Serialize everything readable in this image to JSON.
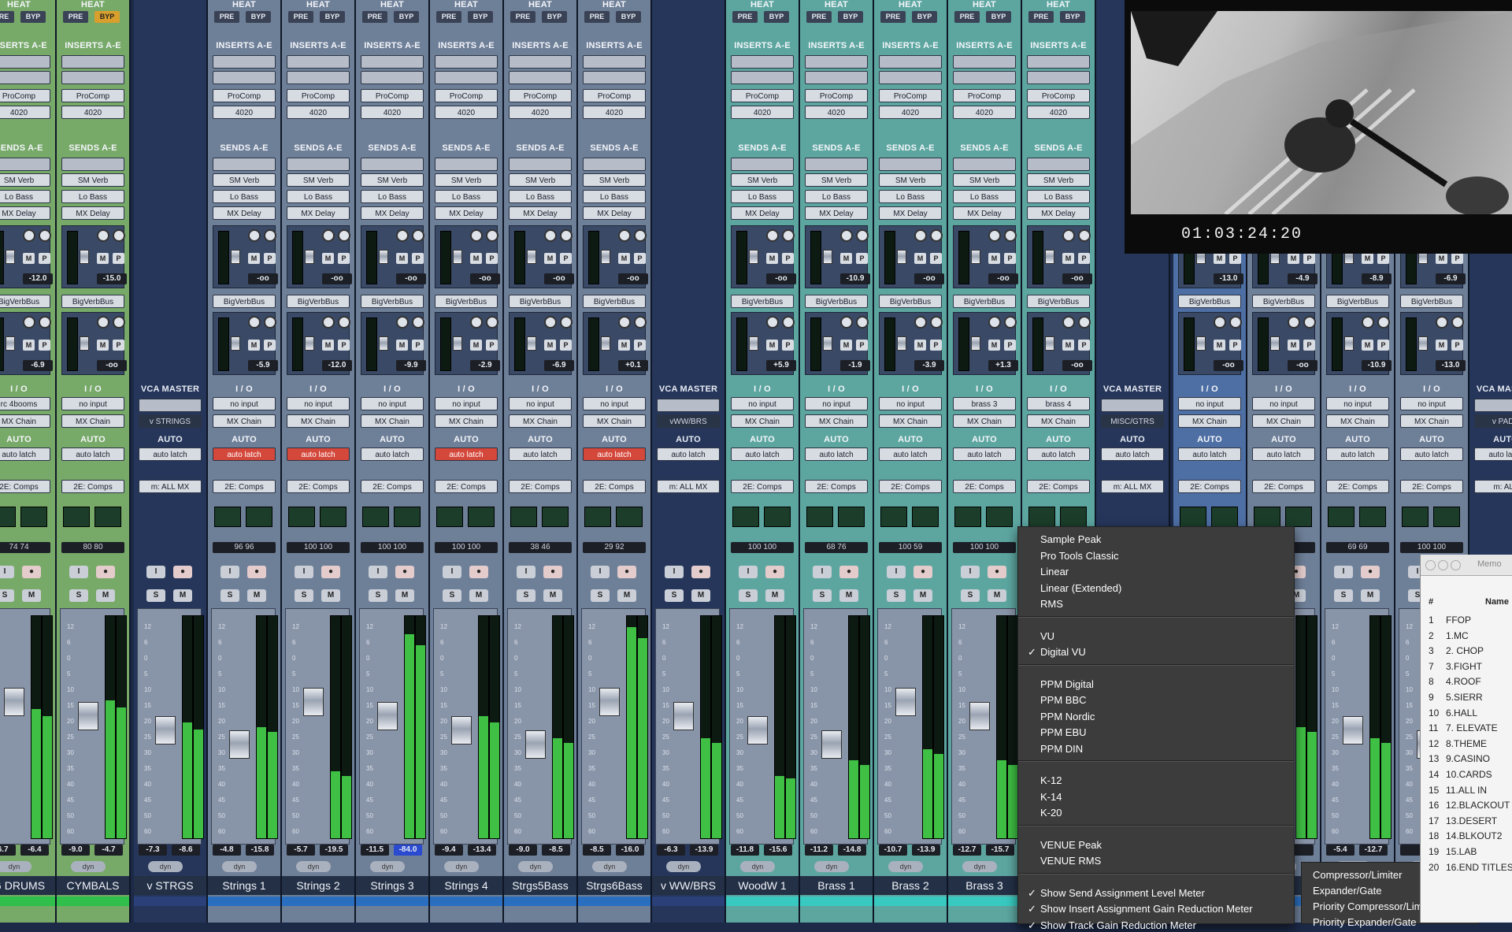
{
  "strip_labels": {
    "heat": "HEAT",
    "pre": "PRE",
    "byp": "BYP",
    "inserts": "INSERTS A-E",
    "sends": "SENDS A-E",
    "io": "I / O",
    "vca_master": "VCA MASTER",
    "auto": "AUTO",
    "dyn": "dyn"
  },
  "tracks": [
    {
      "kind": "audio",
      "color": "green",
      "name": "G DRUMS",
      "insert1": "ProComp",
      "insert2": "4020",
      "sends": [
        "SM Verb",
        "Lo Bass",
        "MX Delay"
      ],
      "send_val1": "-12.0",
      "bus": "BigVerbBus",
      "send_val2": "-6.9",
      "input": "rc 4booms",
      "output": "MX Chain",
      "auto": "auto latch",
      "auto_armed": false,
      "group": "2E: Comps",
      "pan": "74  74",
      "vol_left": "-6.7",
      "vol_right": "-6.4",
      "level": 0.58,
      "byp_on": false
    },
    {
      "kind": "audio",
      "color": "green",
      "name": "CYMBALS",
      "insert1": "ProComp",
      "insert2": "4020",
      "sends": [
        "SM Verb",
        "Lo Bass",
        "MX Delay"
      ],
      "send_val1": "-15.0",
      "bus": "BigVerbBus",
      "send_val2": "-oo",
      "input": "no input",
      "output": "MX Chain",
      "auto": "auto latch",
      "auto_armed": false,
      "group": "2E: Comps",
      "pan": "80  80",
      "vol_left": "-9.0",
      "vol_right": "-4.7",
      "level": 0.62,
      "byp_on": true
    },
    {
      "kind": "vca",
      "color": "vca",
      "name": "v STRGS",
      "vca": "v STRINGS",
      "auto": "auto latch",
      "auto_armed": false,
      "group": "m: ALL MX",
      "vol_left": "-7.3",
      "vol_right": "-8.6",
      "level": 0.52
    },
    {
      "kind": "audio",
      "color": "grey",
      "name": "Strings 1",
      "insert1": "ProComp",
      "insert2": "4020",
      "sends": [
        "SM Verb",
        "Lo Bass",
        "MX Delay"
      ],
      "send_val1": "-oo",
      "bus": "BigVerbBus",
      "send_val2": "-5.9",
      "input": "no input",
      "output": "MX Chain",
      "auto": "auto latch",
      "auto_armed": true,
      "group": "2E: Comps",
      "pan": "96  96",
      "vol_left": "-4.8",
      "vol_right": "-15.8",
      "level": 0.5,
      "byp_on": false
    },
    {
      "kind": "audio",
      "color": "grey",
      "name": "Strings 2",
      "insert1": "ProComp",
      "insert2": "4020",
      "sends": [
        "SM Verb",
        "Lo Bass",
        "MX Delay"
      ],
      "send_val1": "-oo",
      "bus": "BigVerbBus",
      "send_val2": "-12.0",
      "input": "no input",
      "output": "MX Chain",
      "auto": "auto latch",
      "auto_armed": true,
      "group": "2E: Comps",
      "pan": "100  100",
      "vol_left": "-5.7",
      "vol_right": "-19.5",
      "level": 0.3,
      "byp_on": false
    },
    {
      "kind": "audio",
      "color": "grey",
      "name": "Strings 3",
      "insert1": "ProComp",
      "insert2": "4020",
      "sends": [
        "SM Verb",
        "Lo Bass",
        "MX Delay"
      ],
      "send_val1": "-oo",
      "bus": "BigVerbBus",
      "send_val2": "-9.9",
      "input": "no input",
      "output": "MX Chain",
      "auto": "auto latch",
      "auto_armed": false,
      "group": "2E: Comps",
      "pan": "100  100",
      "vol_left": "-11.5",
      "vol_right": "-84.0",
      "level": 0.92,
      "byp_on": false
    },
    {
      "kind": "audio",
      "color": "grey",
      "name": "Strings 4",
      "insert1": "ProComp",
      "insert2": "4020",
      "sends": [
        "SM Verb",
        "Lo Bass",
        "MX Delay"
      ],
      "send_val1": "-oo",
      "bus": "BigVerbBus",
      "send_val2": "-2.9",
      "input": "no input",
      "output": "MX Chain",
      "auto": "auto latch",
      "auto_armed": true,
      "group": "2E: Comps",
      "pan": "100  100",
      "vol_left": "-9.4",
      "vol_right": "-13.4",
      "level": 0.55,
      "byp_on": false
    },
    {
      "kind": "audio",
      "color": "grey",
      "name": "Strgs5Bass",
      "insert1": "ProComp",
      "insert2": "4020",
      "sends": [
        "SM Verb",
        "Lo Bass",
        "MX Delay"
      ],
      "send_val1": "-oo",
      "bus": "BigVerbBus",
      "send_val2": "-6.9",
      "input": "no input",
      "output": "MX Chain",
      "auto": "auto latch",
      "auto_armed": false,
      "group": "2E: Comps",
      "pan": "38  46",
      "vol_left": "-9.0",
      "vol_right": "-8.5",
      "level": 0.45,
      "byp_on": false
    },
    {
      "kind": "audio",
      "color": "grey",
      "name": "Strgs6Bass",
      "insert1": "ProComp",
      "insert2": "4020",
      "sends": [
        "SM Verb",
        "Lo Bass",
        "MX Delay"
      ],
      "send_val1": "-oo",
      "bus": "BigVerbBus",
      "send_val2": "+0.1",
      "input": "no input",
      "output": "MX Chain",
      "auto": "auto latch",
      "auto_armed": true,
      "group": "2E: Comps",
      "pan": "29  92",
      "vol_left": "-8.5",
      "vol_right": "-16.0",
      "level": 0.95,
      "byp_on": false
    },
    {
      "kind": "vca",
      "color": "vca",
      "name": "v WW/BRS",
      "vca": "vWW/BRS",
      "auto": "auto latch",
      "auto_armed": false,
      "group": "m: ALL MX",
      "vol_left": "-6.3",
      "vol_right": "-13.9",
      "level": 0.45
    },
    {
      "kind": "audio",
      "color": "teal",
      "name": "WoodW 1",
      "insert1": "ProComp",
      "insert2": "4020",
      "sends": [
        "SM Verb",
        "Lo Bass",
        "MX Delay"
      ],
      "send_val1": "-oo",
      "bus": "BigVerbBus",
      "send_val2": "+5.9",
      "input": "no input",
      "output": "MX Chain",
      "auto": "auto latch",
      "auto_armed": false,
      "group": "2E: Comps",
      "pan": "100  100",
      "vol_left": "-11.8",
      "vol_right": "-15.6",
      "level": 0.28,
      "byp_on": false
    },
    {
      "kind": "audio",
      "color": "teal",
      "name": "Brass 1",
      "insert1": "ProComp",
      "insert2": "4020",
      "sends": [
        "SM Verb",
        "Lo Bass",
        "MX Delay"
      ],
      "send_val1": "-10.9",
      "bus": "BigVerbBus",
      "send_val2": "-1.9",
      "input": "no input",
      "output": "MX Chain",
      "auto": "auto latch",
      "auto_armed": false,
      "group": "2E: Comps",
      "pan": "68  76",
      "vol_left": "-11.2",
      "vol_right": "-14.8",
      "level": 0.35,
      "byp_on": false
    },
    {
      "kind": "audio",
      "color": "teal",
      "name": "Brass 2",
      "insert1": "ProComp",
      "insert2": "4020",
      "sends": [
        "SM Verb",
        "Lo Bass",
        "MX Delay"
      ],
      "send_val1": "-oo",
      "bus": "BigVerbBus",
      "send_val2": "-3.9",
      "input": "no input",
      "output": "MX Chain",
      "auto": "auto latch",
      "auto_armed": false,
      "group": "2E: Comps",
      "pan": "100  59",
      "vol_left": "-10.7",
      "vol_right": "-13.9",
      "level": 0.4,
      "byp_on": false
    },
    {
      "kind": "audio",
      "color": "teal",
      "name": "Brass 3",
      "insert1": "ProComp",
      "insert2": "4020",
      "sends": [
        "SM Verb",
        "Lo Bass",
        "MX Delay"
      ],
      "send_val1": "-oo",
      "bus": "BigVerbBus",
      "send_val2": "+1.3",
      "input": "brass 3",
      "output": "MX Chain",
      "auto": "auto latch",
      "auto_armed": false,
      "group": "2E: Comps",
      "pan": "100  100",
      "vol_left": "-12.7",
      "vol_right": "-15.7",
      "level": 0.35,
      "byp_on": false
    },
    {
      "kind": "audio",
      "color": "teal",
      "name": "Brass 4",
      "insert1": "ProComp",
      "insert2": "4020",
      "sends": [
        "SM Verb",
        "Lo Bass",
        "MX Delay"
      ],
      "send_val1": "-oo",
      "bus": "BigVerbBus",
      "send_val2": "-oo",
      "input": "brass 4",
      "output": "MX Chain",
      "auto": "auto latch",
      "auto_armed": false,
      "group": "2E: Comps",
      "pan": "",
      "vol_left": "",
      "vol_right": "",
      "level": 0.3,
      "byp_on": false
    },
    {
      "kind": "vca",
      "color": "vca",
      "name": "",
      "vca": "MISC/GTRS",
      "auto": "auto latch",
      "auto_armed": false,
      "group": "m: ALL MX",
      "vol_left": "",
      "vol_right": "",
      "level": 0.3
    },
    {
      "kind": "audio",
      "color": "blue",
      "name": "",
      "insert1": "",
      "insert2": "",
      "sends": [
        "",
        "",
        ""
      ],
      "send_val1": "-13.0",
      "bus": "BigVerbBus",
      "send_val2": "-oo",
      "input": "no input",
      "output": "MX Chain",
      "auto": "auto latch",
      "auto_armed": false,
      "group": "2E: Comps",
      "pan": "",
      "vol_left": "",
      "vol_right": "",
      "level": 0.5,
      "byp_on": false
    },
    {
      "kind": "audio",
      "color": "grey",
      "name": "",
      "insert1": "",
      "insert2": "",
      "sends": [
        "",
        "",
        ""
      ],
      "send_val1": "-4.9",
      "bus": "BigVerbBus",
      "send_val2": "-oo",
      "input": "no input",
      "output": "MX Chain",
      "auto": "auto latch",
      "auto_armed": false,
      "group": "2E: Comps",
      "pan": "",
      "vol_left": "",
      "vol_right": "",
      "level": 0.5,
      "byp_on": false
    },
    {
      "kind": "audio",
      "color": "grey",
      "name": "",
      "insert1": "",
      "insert2": "",
      "sends": [
        "",
        "",
        ""
      ],
      "send_val1": "-8.9",
      "bus": "BigVerbBus",
      "send_val2": "-10.9",
      "input": "no input",
      "output": "MX Chain",
      "auto": "auto latch",
      "auto_armed": false,
      "group": "2E: Comps",
      "pan": "69  69",
      "vol_left": "-5.4",
      "vol_right": "-12.7",
      "level": 0.45,
      "byp_on": false
    },
    {
      "kind": "audio",
      "color": "grey",
      "name": "",
      "insert1": "",
      "insert2": "",
      "sends": [
        "",
        "",
        ""
      ],
      "send_val1": "-6.9",
      "bus": "BigVerbBus",
      "send_val2": "-13.0",
      "input": "no input",
      "output": "MX Chain",
      "auto": "auto latch",
      "auto_armed": false,
      "group": "2E: Comps",
      "pan": "100  100",
      "vol_left": "",
      "vol_right": "",
      "level": 0.5,
      "byp_on": false
    },
    {
      "kind": "vca",
      "color": "vca",
      "name": "",
      "vca": "v PADS",
      "auto": "auto latch",
      "auto_armed": false,
      "group": "m: ALL",
      "vol_left": "",
      "vol_right": "",
      "level": 0.5
    }
  ],
  "scale_ticks": [
    "12",
    "6",
    "0",
    "5",
    "10",
    "15",
    "20",
    "25",
    "30",
    "35",
    "40",
    "45",
    "50",
    "60"
  ],
  "video": {
    "timecode": "01:03:24:20"
  },
  "meter_menu": {
    "groups": [
      [
        {
          "label": "Sample Peak",
          "checked": false
        },
        {
          "label": "Pro Tools Classic",
          "checked": false
        },
        {
          "label": "Linear",
          "checked": false
        },
        {
          "label": "Linear (Extended)",
          "checked": false
        },
        {
          "label": "RMS",
          "checked": false
        }
      ],
      [
        {
          "label": "VU",
          "checked": false
        },
        {
          "label": "Digital VU",
          "checked": true
        }
      ],
      [
        {
          "label": "PPM Digital",
          "checked": false
        },
        {
          "label": "PPM BBC",
          "checked": false
        },
        {
          "label": "PPM Nordic",
          "checked": false
        },
        {
          "label": "PPM EBU",
          "checked": false
        },
        {
          "label": "PPM DIN",
          "checked": false
        }
      ],
      [
        {
          "label": "K-12",
          "checked": false
        },
        {
          "label": "K-14",
          "checked": false
        },
        {
          "label": "K-20",
          "checked": false
        }
      ],
      [
        {
          "label": "VENUE Peak",
          "checked": false
        },
        {
          "label": "VENUE RMS",
          "checked": false
        }
      ],
      [
        {
          "label": "Show Send Assignment Level Meter",
          "checked": true
        },
        {
          "label": "Show Insert Assignment Gain Reduction Meter",
          "checked": true
        },
        {
          "label": "Show Track Gain Reduction Meter",
          "checked": true
        }
      ]
    ]
  },
  "gain_reduction_submenu": [
    "Compressor/Limiter",
    "Expander/Gate",
    "Priority Compressor/Limiter",
    "Priority Expander/Gate"
  ],
  "memory_window": {
    "title": "Memo",
    "column_header": "Name",
    "header_hash": "#",
    "rows": [
      {
        "n": "1",
        "name": "FFOP"
      },
      {
        "n": "2",
        "name": "1.MC"
      },
      {
        "n": "3",
        "name": "2. CHOP"
      },
      {
        "n": "7",
        "name": "3.FIGHT"
      },
      {
        "n": "8",
        "name": "4.ROOF"
      },
      {
        "n": "9",
        "name": "5.SIERR"
      },
      {
        "n": "10",
        "name": "6.HALL"
      },
      {
        "n": "11",
        "name": "7. ELEVATE"
      },
      {
        "n": "12",
        "name": "8.THEME"
      },
      {
        "n": "13",
        "name": "9.CASINO"
      },
      {
        "n": "14",
        "name": "10.CARDS"
      },
      {
        "n": "15",
        "name": "11.ALL IN"
      },
      {
        "n": "16",
        "name": "12.BLACKOUT"
      },
      {
        "n": "17",
        "name": "13.DESERT"
      },
      {
        "n": "18",
        "name": "14.BLKOUT2"
      },
      {
        "n": "19",
        "name": "15.LAB"
      },
      {
        "n": "20",
        "name": "16.END TITLES"
      }
    ]
  },
  "colors": {
    "green": "#77a968",
    "grey": "#6e7f98",
    "teal": "#5da6a0",
    "blue": "#4e6fa4",
    "vca": "#26365a",
    "green_bar": "#2fbf4a",
    "teal_bar": "#38c9c0",
    "grey_bar": "#2a6fbf",
    "vca_bar": "#2b3f78",
    "blue_bar": "#2a6fbf"
  }
}
